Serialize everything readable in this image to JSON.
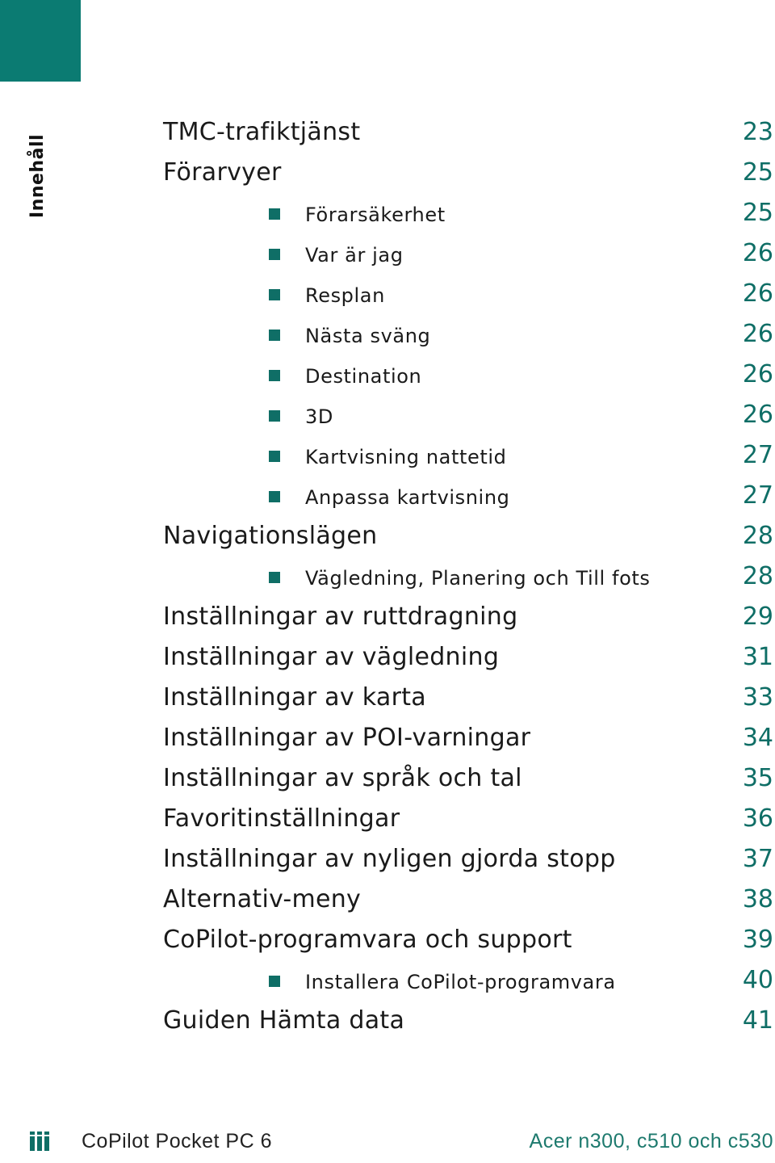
{
  "side_label": "Innehåll",
  "colors": {
    "accent": "#0b7b72",
    "page_number": "#0f6e66",
    "text": "#1a1a1a"
  },
  "toc": [
    {
      "level": 1,
      "title": "TMC-trafiktjänst",
      "page": "23"
    },
    {
      "level": 1,
      "title": "Förarvyer",
      "page": "25"
    },
    {
      "level": 2,
      "title": "Förarsäkerhet",
      "page": "25"
    },
    {
      "level": 2,
      "title": "Var är jag",
      "page": "26"
    },
    {
      "level": 2,
      "title": "Resplan",
      "page": "26"
    },
    {
      "level": 2,
      "title": "Nästa sväng",
      "page": "26"
    },
    {
      "level": 2,
      "title": "Destination",
      "page": "26"
    },
    {
      "level": 2,
      "title": "3D",
      "page": "26"
    },
    {
      "level": 2,
      "title": "Kartvisning nattetid",
      "page": "27"
    },
    {
      "level": 2,
      "title": "Anpassa kartvisning",
      "page": "27"
    },
    {
      "level": 1,
      "title": "Navigationslägen",
      "page": "28"
    },
    {
      "level": 2,
      "title": "Vägledning, Planering och Till fots",
      "page": "28"
    },
    {
      "level": 1,
      "title": "Inställningar av ruttdragning",
      "page": "29"
    },
    {
      "level": 1,
      "title": "Inställningar av vägledning",
      "page": "31"
    },
    {
      "level": 1,
      "title": "Inställningar av karta",
      "page": "33"
    },
    {
      "level": 1,
      "title": "Inställningar av POI-varningar",
      "page": "34"
    },
    {
      "level": 1,
      "title": "Inställningar av språk och tal",
      "page": "35"
    },
    {
      "level": 1,
      "title": "Favoritinställningar",
      "page": "36"
    },
    {
      "level": 1,
      "title": "Inställningar av nyligen gjorda stopp",
      "page": "37"
    },
    {
      "level": 1,
      "title": "Alternativ-meny",
      "page": "38"
    },
    {
      "level": 1,
      "title": "CoPilot-programvara och support",
      "page": "39"
    },
    {
      "level": 2,
      "title": "Installera CoPilot-programvara",
      "page": "40"
    },
    {
      "level": 1,
      "title": "Guiden Hämta data",
      "page": "41"
    }
  ],
  "footer": {
    "icon": "book-stack-icon",
    "left": "CoPilot Pocket PC 6",
    "right": "Acer n300, c510 och c530"
  }
}
